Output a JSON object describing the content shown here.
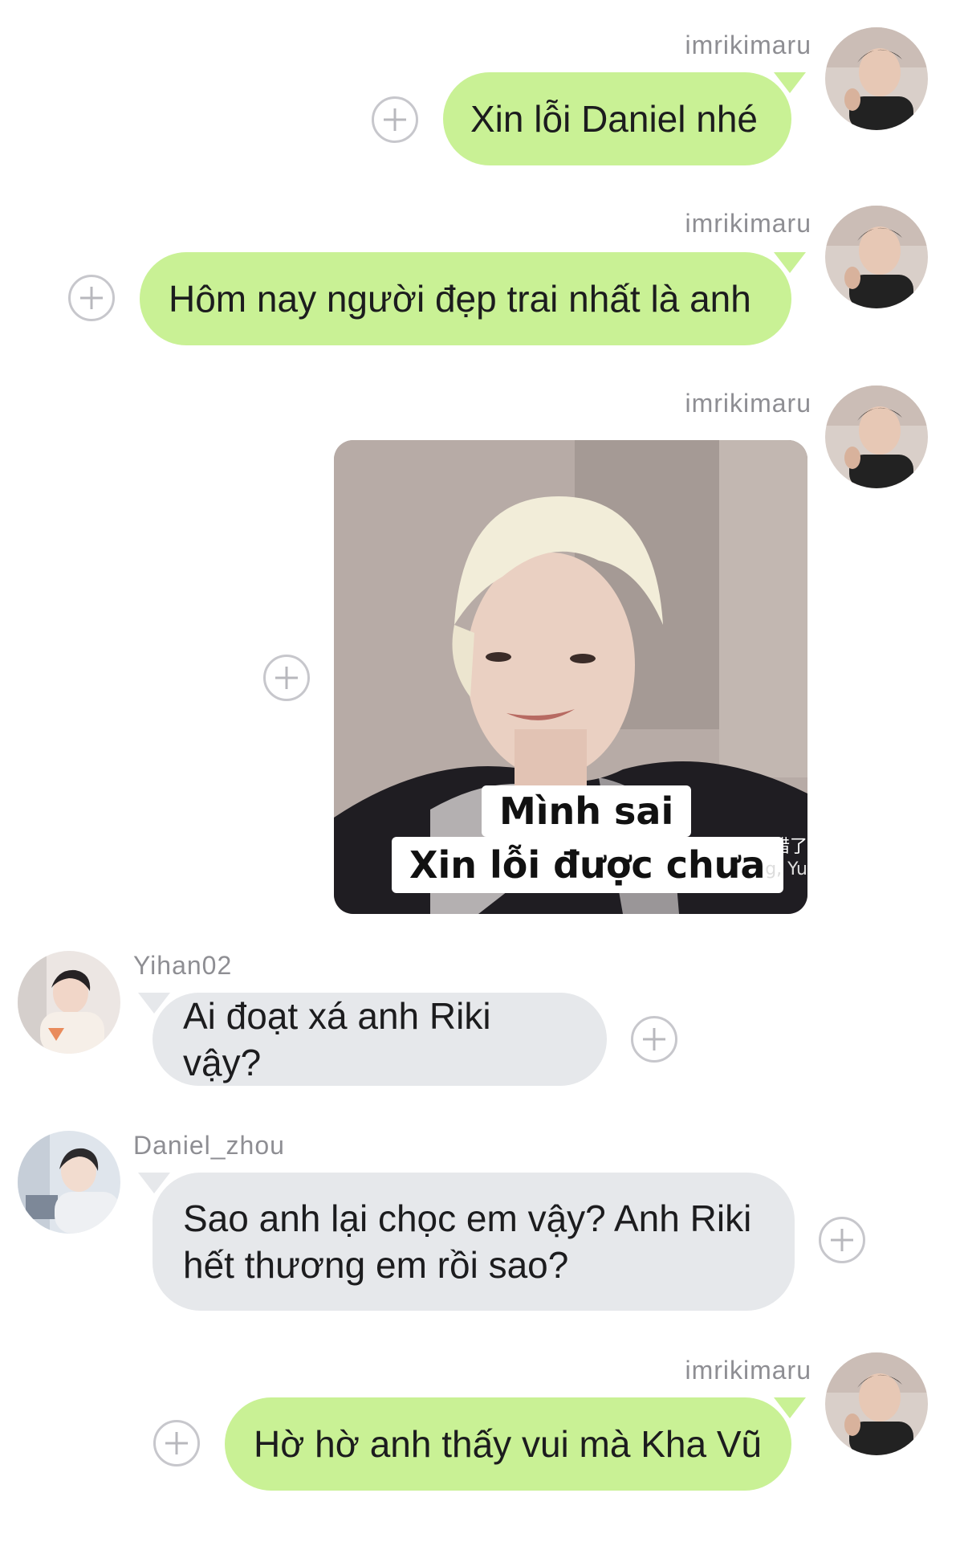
{
  "messages": [
    {
      "user": "imrikimaru",
      "text": "Xin lỗi Daniel nhé"
    },
    {
      "user": "imrikimaru",
      "text": "Hôm nay người đẹp trai nhất là anh"
    },
    {
      "user": "imrikimaru",
      "sticker": {
        "caption_line1": "Mình sai",
        "caption_line2": "Xin lỗi được chưa",
        "cn_text": "我错了",
        "cn_text2": "g, Yu"
      }
    },
    {
      "user": "Yihan02",
      "text": "Ai đoạt xá anh Riki vậy?"
    },
    {
      "user": "Daniel_zhou",
      "text": "Sao anh lại chọc em vậy? Anh Riki hết thương em rồi sao?"
    },
    {
      "user": "imrikimaru",
      "text": "Hờ hờ anh thấy vui mà Kha Vũ"
    }
  ],
  "colors": {
    "outgoing_bubble": "#c9f195",
    "incoming_bubble": "#e6e8eb",
    "username": "#8e8e93",
    "plus_icon": "#c7c7cc"
  },
  "icons": {
    "add": "plus-circle-icon",
    "avatar": "user-avatar"
  }
}
